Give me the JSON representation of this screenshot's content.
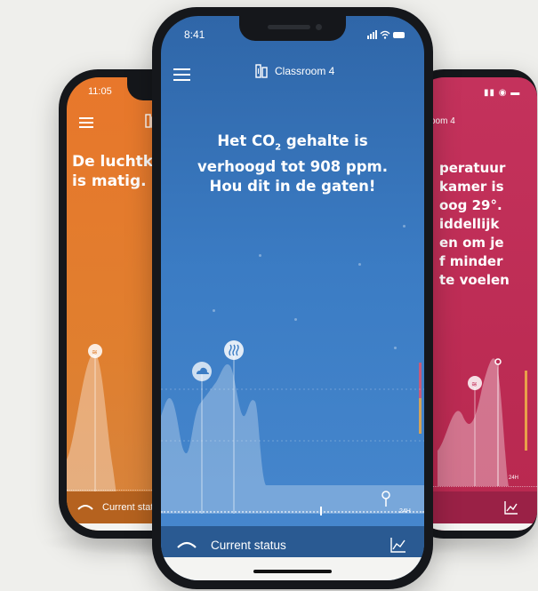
{
  "center": {
    "time": "8:41",
    "room_title": "Classroom 4",
    "message_line1_pre": "Het CO",
    "message_line1_sub": "2",
    "message_line1_post": " gehalte is",
    "message_line2": "verhoogd tot 908 ppm.",
    "message_line3": "Hou dit in de gaten!",
    "axis_label": "24H",
    "status_bar_label": "Current status",
    "icons": {
      "menu": "hamburger-menu-icon",
      "room": "building-icon",
      "cloud": "cloud-icon",
      "heat": "heat-icon",
      "pin": "location-pin-icon",
      "trend": "line-chart-icon",
      "wave": "wave-icon"
    },
    "accent": "#3b7cc4"
  },
  "left": {
    "time": "11:05",
    "message_line1": "De luchtk",
    "message_line2": "is matig.",
    "status_bar_label": "Current stat",
    "accent": "#e8772b"
  },
  "right": {
    "room_title": "oom 4",
    "message_lines": [
      "peratuur",
      "kamer is",
      "oog 29°.",
      "iddellijk",
      "en om je",
      "f minder",
      "te voelen"
    ],
    "axis_label": "24H",
    "accent": "#c4325c"
  }
}
